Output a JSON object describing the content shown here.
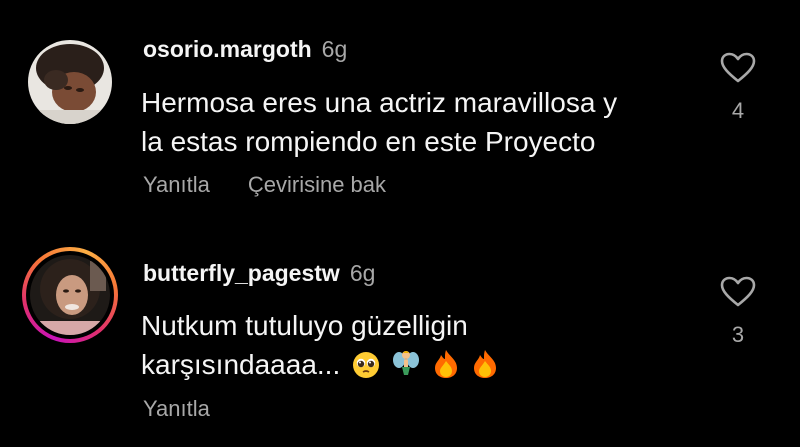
{
  "comments": [
    {
      "username": "osorio.margoth",
      "time": "6g",
      "text_lines": [
        "Hermosa eres una actriz maravillosa y",
        "la estas rompiendo en este Proyecto"
      ],
      "actions": [
        "Yanıtla",
        "Çevirisine bak"
      ],
      "likes": "4",
      "has_story_ring": false
    },
    {
      "username": "butterfly_pagestw",
      "time": "6g",
      "text_lines": [
        "Nutkum tutuluyo güzelligin",
        "karşısındaaaa..."
      ],
      "emojis": [
        "pleading-face",
        "fairy",
        "fire",
        "fire"
      ],
      "actions": [
        "Yanıtla"
      ],
      "likes": "3",
      "has_story_ring": true
    }
  ],
  "colors": {
    "background": "#000000",
    "primary_text": "#f5f5f5",
    "secondary_text": "#a8a8a8"
  },
  "icons": {
    "like": "heart-outline-icon"
  }
}
